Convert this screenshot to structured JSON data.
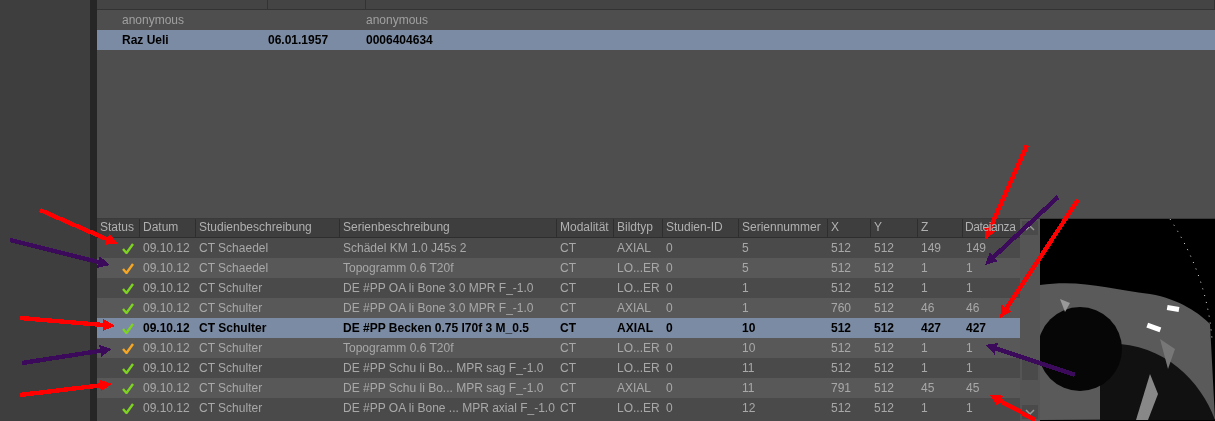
{
  "patients": {
    "rows": [
      {
        "cells": [
          "anonymous",
          "",
          "anonymous"
        ],
        "selected": false
      },
      {
        "cells": [
          "Raz Ueli",
          "06.01.1957",
          "0006404634"
        ],
        "selected": true
      }
    ]
  },
  "series": {
    "status_column": "Status",
    "columns": [
      "Datum",
      "Studienbeschreibung",
      "Serienbeschreibung",
      "Modalität",
      "Bildtyp",
      "Studien-ID",
      "Seriennummer",
      "X",
      "Y",
      "Z",
      "Dateianza"
    ],
    "rows": [
      {
        "color": "#7ed321",
        "selected": false,
        "cells": [
          "09.10.12",
          "CT Schaedel",
          "Schädel KM  1.0  J45s  2",
          "CT",
          "AXIAL",
          "0",
          "5",
          "512",
          "512",
          "149",
          "149"
        ]
      },
      {
        "color": "#f5a623",
        "selected": false,
        "cells": [
          "09.10.12",
          "CT Schaedel",
          "Topogramm  0.6  T20f",
          "CT",
          "LO...ER",
          "0",
          "5",
          "512",
          "512",
          "1",
          "1"
        ]
      },
      {
        "color": "#7ed321",
        "selected": false,
        "cells": [
          "09.10.12",
          "CT Schulter",
          "DE #PP  OA li Bone 3.0  MPR  F_-1.0",
          "CT",
          "LO...ER",
          "0",
          "1",
          "512",
          "512",
          "1",
          "1"
        ]
      },
      {
        "color": "#7ed321",
        "selected": false,
        "cells": [
          "09.10.12",
          "CT Schulter",
          "DE #PP  OA li Bone 3.0  MPR  F_-1.0",
          "CT",
          "AXIAL",
          "0",
          "1",
          "760",
          "512",
          "46",
          "46"
        ]
      },
      {
        "color": "#7ed321",
        "selected": true,
        "cells": [
          "09.10.12",
          "CT Schulter",
          "DE #PP  Becken  0.75  I70f  3  M_0.5",
          "CT",
          "AXIAL",
          "0",
          "10",
          "512",
          "512",
          "427",
          "427"
        ]
      },
      {
        "color": "#f5a623",
        "selected": false,
        "cells": [
          "09.10.12",
          "CT Schulter",
          "Topogramm  0.6  T20f",
          "CT",
          "LO...ER",
          "0",
          "10",
          "512",
          "512",
          "1",
          "1"
        ]
      },
      {
        "color": "#7ed321",
        "selected": false,
        "cells": [
          "09.10.12",
          "CT Schulter",
          "DE #PP  Schu li Bo...  MPR  sag  F_-1.0",
          "CT",
          "LO...ER",
          "0",
          "11",
          "512",
          "512",
          "1",
          "1"
        ]
      },
      {
        "color": "#7ed321",
        "selected": false,
        "cells": [
          "09.10.12",
          "CT Schulter",
          "DE #PP  Schu li Bo...  MPR  sag  F_-1.0",
          "CT",
          "AXIAL",
          "0",
          "11",
          "791",
          "512",
          "45",
          "45"
        ]
      },
      {
        "color": "#7ed321",
        "selected": false,
        "cells": [
          "09.10.12",
          "CT Schulter",
          "DE #PP  OA li Bone ... MPR  axial  F_-1.0",
          "CT",
          "LO...ER",
          "0",
          "12",
          "512",
          "512",
          "1",
          "1"
        ]
      }
    ]
  },
  "annotation_arrows": [
    {
      "color": "#ff0000"
    },
    {
      "color": "#3c0a5a"
    },
    {
      "color": "#ff0000"
    },
    {
      "color": "#3c0a5a"
    },
    {
      "color": "#ff0000"
    },
    {
      "color": "#ff0000"
    },
    {
      "color": "#3c0a5a"
    },
    {
      "color": "#ff0000"
    },
    {
      "color": "#3c0a5a"
    },
    {
      "color": "#ff0000"
    }
  ]
}
